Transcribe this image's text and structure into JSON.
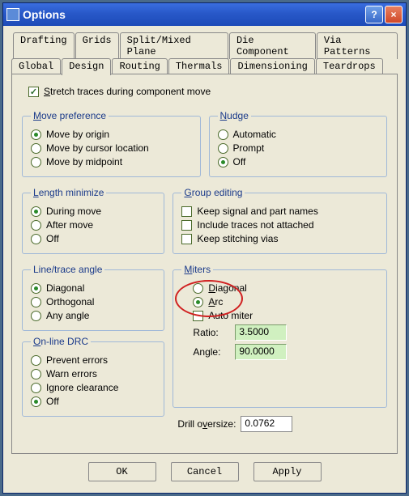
{
  "window": {
    "title": "Options"
  },
  "title_buttons": {
    "min": "_",
    "help": "?",
    "close": "×"
  },
  "tabs_row1": [
    "Drafting",
    "Grids",
    "Split/Mixed Plane",
    "Die Component",
    "Via Patterns"
  ],
  "tabs_row2": [
    "Global",
    "Design",
    "Routing",
    "Thermals",
    "Dimensioning",
    "Teardrops"
  ],
  "active_tab": "Design",
  "stretch_label_pre": "S",
  "stretch_label_post": "tretch traces during component move",
  "groups": {
    "move_pref": {
      "legend_u": "M",
      "legend_post": "ove preference",
      "opts": [
        {
          "u": "",
          "label": "Move by origin",
          "sel": true
        },
        {
          "u": "",
          "label": "Move by cursor location",
          "sel": false
        },
        {
          "u": "",
          "label": "Move by midpoint",
          "sel": false
        }
      ]
    },
    "nudge": {
      "legend_u": "N",
      "legend_post": "udge",
      "opts": [
        {
          "label": "Automatic",
          "sel": false
        },
        {
          "label": "Prompt",
          "sel": false
        },
        {
          "label": "Off",
          "sel": true
        }
      ]
    },
    "length_min": {
      "legend_u": "L",
      "legend_post": "ength minimize",
      "opts": [
        {
          "label": "During move",
          "sel": true
        },
        {
          "label": "After move",
          "sel": false
        },
        {
          "label": "Off",
          "sel": false
        }
      ]
    },
    "group_edit": {
      "legend_u": "G",
      "legend_post": "roup editing",
      "chks": [
        {
          "label": "Keep signal and part names",
          "sel": false
        },
        {
          "label": "Include traces not attached",
          "sel": false
        },
        {
          "label": "Keep stitching vias",
          "sel": false
        }
      ]
    },
    "line_angle": {
      "legend": "Line/trace angle",
      "opts": [
        {
          "label": "Diagonal",
          "sel": true
        },
        {
          "label": "Orthogonal",
          "sel": false
        },
        {
          "label": "Any angle",
          "sel": false
        }
      ]
    },
    "miters": {
      "legend_u": "M",
      "legend_post": "iters",
      "opts": [
        {
          "u": "D",
          "post": "iagonal",
          "sel": false
        },
        {
          "u": "A",
          "post": "rc",
          "sel": true
        }
      ],
      "auto_label": "Auto miter",
      "auto_sel": false,
      "ratio_label": "Ratio:",
      "ratio_val": "3.5000",
      "angle_label": "Angle:",
      "angle_val": "90.0000"
    },
    "drc": {
      "legend_u": "O",
      "legend_post": "n-line DRC",
      "opts": [
        {
          "label": "Prevent errors",
          "sel": false
        },
        {
          "label": "Warn errors",
          "sel": false
        },
        {
          "label": "Ignore clearance",
          "sel": false
        },
        {
          "label": "Off",
          "sel": true
        }
      ]
    },
    "drill": {
      "pre": "Drill o",
      "u": "v",
      "post": "ersize:",
      "val": "0.0762"
    }
  },
  "buttons": {
    "ok": "OK",
    "cancel": "Cancel",
    "apply": "Apply"
  }
}
